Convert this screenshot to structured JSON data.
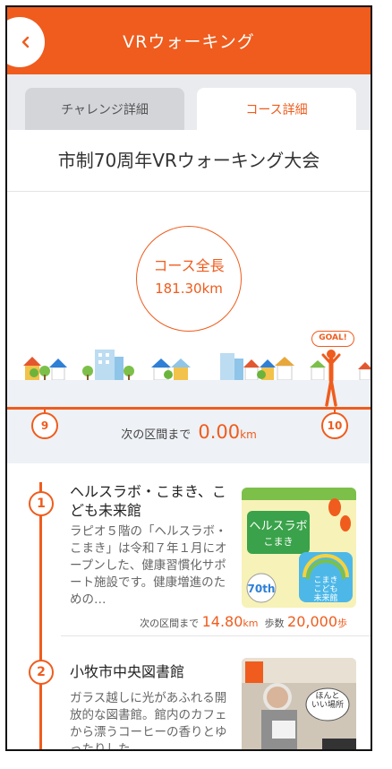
{
  "header": {
    "title": "VRウォーキング",
    "back_icon": "chevron-left-icon"
  },
  "tabs": [
    {
      "label": "チャレンジ詳細",
      "active": false
    },
    {
      "label": "コース詳細",
      "active": true
    }
  ],
  "event": {
    "title": "市制70周年VRウォーキング大会"
  },
  "course": {
    "total_label": "コース全長",
    "total_value": "181.30km"
  },
  "route": {
    "goal_label": "GOAL!",
    "markers": [
      "9",
      "10"
    ],
    "next_label": "次の区間まで",
    "next_value": "0.00",
    "next_unit": "km"
  },
  "spots": [
    {
      "number": "1",
      "name": "ヘルスラボ・こまき、こども未来館",
      "description": "ラピオ５階の「ヘルスラボ・こまき」は令和７年１月にオープンした、健康習慣化サポート施設です。健康増進のための…",
      "next_label": "次の区間まで",
      "next_value": "14.80",
      "next_unit": "km",
      "steps_label": "歩数",
      "steps_value": "20,000",
      "steps_unit": "歩",
      "image_text": {
        "main": "ヘルスラボ",
        "sub": "こまき",
        "kids": "こまき\nこども\n未来館",
        "anniv": "70th"
      }
    },
    {
      "number": "2",
      "name": "小牧市中央図書館",
      "description": "ガラス越しに光があふれる開放的な図書館。館内のカフェから漂うコーヒーの香りとゆったりした",
      "image_text": {
        "bubble": "ほんと\nいい場所"
      }
    }
  ],
  "colors": {
    "accent": "#ef5c1d",
    "tab_bg": "#e9ebee",
    "band_bg": "#eef1f5"
  }
}
